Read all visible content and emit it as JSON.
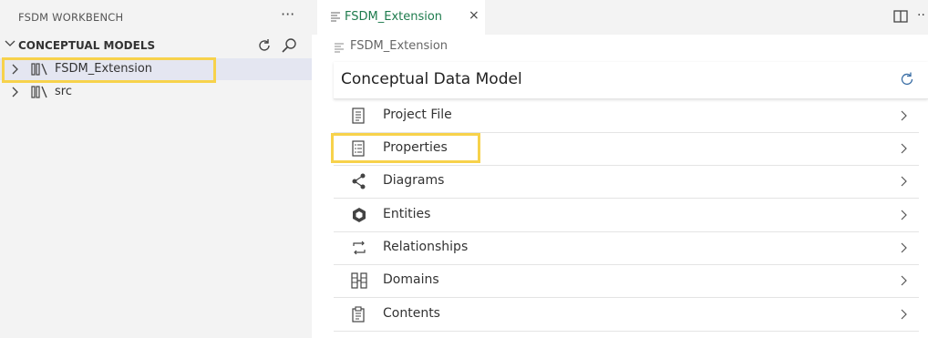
{
  "sidebar": {
    "header": "FSDM WORKBENCH",
    "more_icon": "ellipsis-icon",
    "section": {
      "title": "CONCEPTUAL MODELS",
      "refresh_icon": "refresh-icon",
      "search_icon": "search-icon"
    },
    "items": [
      {
        "label": "FSDM_Extension",
        "icon": "library-icon",
        "selected": true
      },
      {
        "label": "src",
        "icon": "library-icon",
        "selected": false
      }
    ]
  },
  "editor": {
    "tab": {
      "label": "FSDM_Extension",
      "close": "×"
    },
    "breadcrumb": "FSDM_Extension",
    "panel_title": "Conceptual Data Model",
    "rows": [
      {
        "label": "Project File",
        "icon": "document-icon"
      },
      {
        "label": "Properties",
        "icon": "list-icon"
      },
      {
        "label": "Diagrams",
        "icon": "share-nodes-icon"
      },
      {
        "label": "Entities",
        "icon": "cube-icon"
      },
      {
        "label": "Relationships",
        "icon": "relationship-arrows-icon"
      },
      {
        "label": "Domains",
        "icon": "domain-grid-icon"
      },
      {
        "label": "Contents",
        "icon": "clipboard-icon"
      }
    ]
  },
  "colors": {
    "highlight": "#f7d24b",
    "tab_text": "#1e7b4d",
    "selection": "#e4e6f1"
  }
}
